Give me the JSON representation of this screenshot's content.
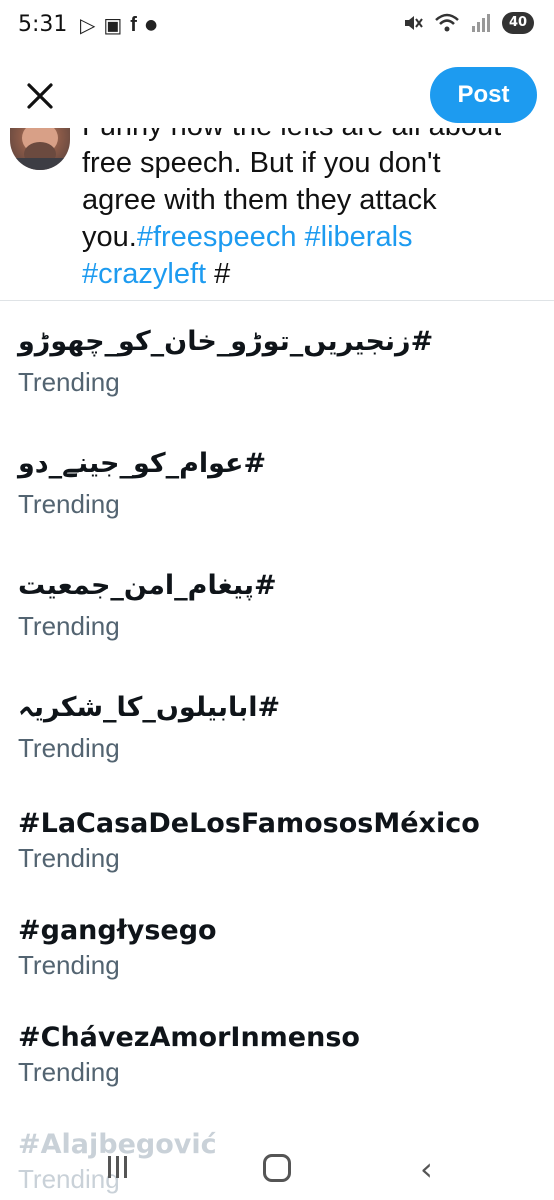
{
  "status_bar": {
    "time": "5:31",
    "battery": "40",
    "left_icons": [
      "play-icon",
      "card-icon",
      "facebook-icon",
      "dot-icon"
    ],
    "right_icons": [
      "mute-icon",
      "wifi-icon",
      "signal-icon",
      "battery-icon"
    ]
  },
  "compose": {
    "post_label": "Post"
  },
  "draft": {
    "line_partial": "Funny how the lefts are all about",
    "text_plain_1": "free speech. But if you don't agree with them they attack you.",
    "hashtag_1": "#freespeech",
    "hashtag_2": "#liberals",
    "hashtag_3": "#crazyleft",
    "trailing": "#"
  },
  "trends": [
    {
      "title": "#زنجیریں_توڑو_خان_کو_چھوڑو",
      "subtitle": "Trending"
    },
    {
      "title": "#عوام_کو_جینے_دو",
      "subtitle": "Trending"
    },
    {
      "title": "#پیغام_امن_جمعیت",
      "subtitle": "Trending"
    },
    {
      "title": "#ابابیلوں_کا_شکریہ",
      "subtitle": "Trending"
    },
    {
      "title": "#LaCasaDeLosFamososMéxico",
      "subtitle": "Trending"
    },
    {
      "title": "#gangłysego",
      "subtitle": "Trending"
    },
    {
      "title": "#ChávezAmorInmenso",
      "subtitle": "Trending"
    },
    {
      "title": "#Alajbegović",
      "subtitle": "Trending"
    }
  ],
  "colors": {
    "accent": "#1d9bf0",
    "text": "#0f1419",
    "secondary": "#536471"
  }
}
